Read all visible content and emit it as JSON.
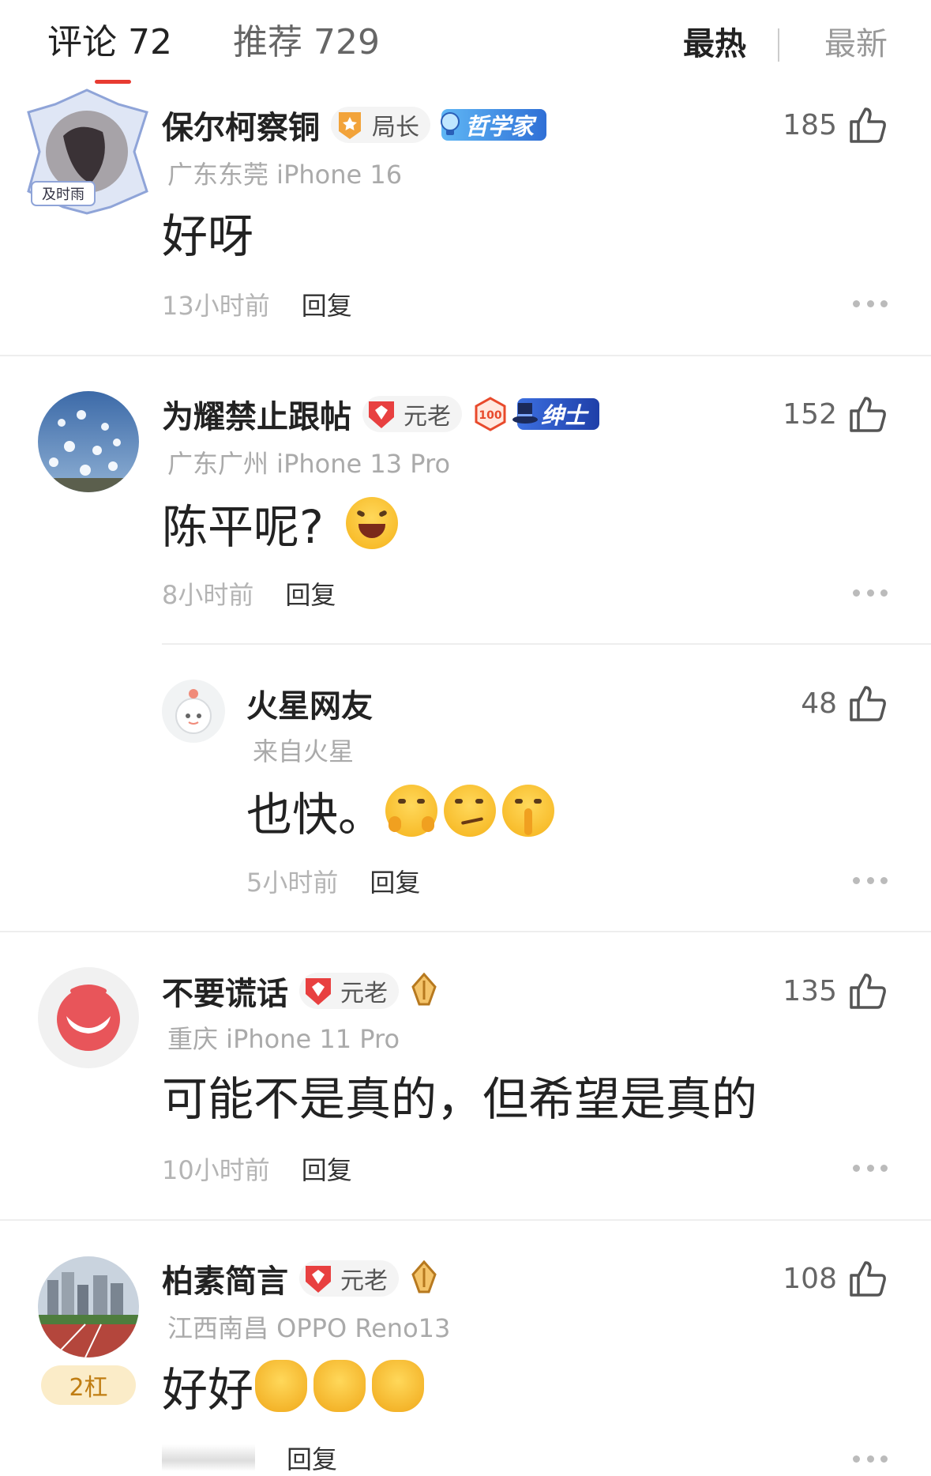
{
  "header": {
    "tab_comments": "评论 72",
    "tab_recommend": "推荐 729",
    "sort_hot": "最热",
    "sort_new": "最新"
  },
  "comments": [
    {
      "username": "保尔柯察铜",
      "rank": "局长",
      "title_badge": "哲学家",
      "avatar_caption": "及时雨",
      "location": "广东东莞 iPhone 16",
      "text": "好呀",
      "time": "13小时前",
      "reply": "回复",
      "likes": "185"
    },
    {
      "username": "为耀禁止跟帖",
      "rank": "元老",
      "title_badge": "绅士",
      "location": "广东广州 iPhone 13 Pro",
      "text": "陈平呢?",
      "emoji": [
        "laughing-emoji"
      ],
      "time": "8小时前",
      "reply": "回复",
      "likes": "152"
    },
    {
      "username": "火星网友",
      "location": "来自火星",
      "text": "也快。",
      "emoji": [
        "hugging-emoji",
        "smirk-emoji",
        "shushing-emoji"
      ],
      "time": "5小时前",
      "reply": "回复",
      "likes": "48"
    },
    {
      "username": "不要谎话",
      "rank": "元老",
      "location": "重庆 iPhone 11 Pro",
      "text": "可能不是真的，但希望是真的",
      "time": "10小时前",
      "reply": "回复",
      "likes": "135"
    },
    {
      "username": "柏素简言",
      "rank": "元老",
      "streak": "2杠",
      "location": "江西南昌 OPPO Reno13",
      "text": "好好",
      "emoji": [
        "waving-hand-emoji",
        "waving-hand-emoji",
        "waving-hand-emoji"
      ],
      "reply": "回复",
      "likes": "108"
    }
  ],
  "colors": {
    "accent": "#e83b31",
    "muted": "#aaaaaa",
    "badge_blue": "#2f6fd6"
  }
}
